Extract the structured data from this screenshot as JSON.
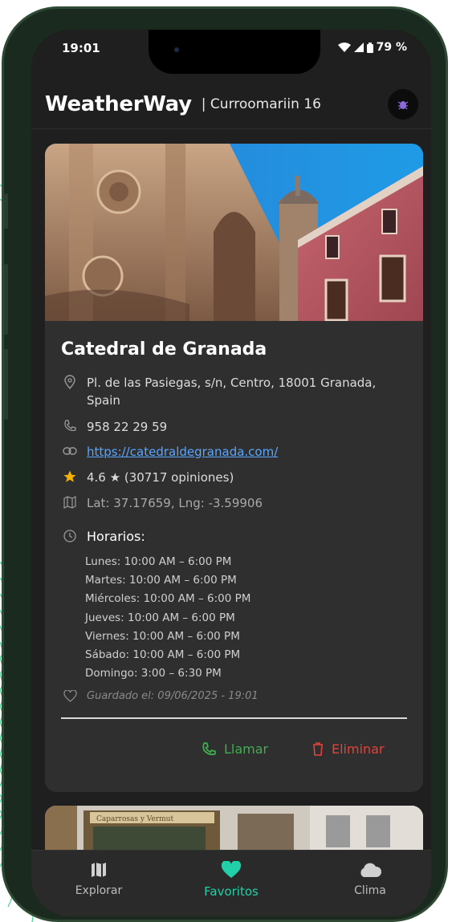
{
  "status_bar": {
    "time": "19:01",
    "battery": "79 %"
  },
  "header": {
    "brand": "WeatherWay",
    "separator": "|",
    "username": "Curroomariin 16"
  },
  "place": {
    "name": "Catedral de Granada",
    "address": "Pl. de las Pasiegas, s/n, Centro, 18001 Granada, Spain",
    "phone": "958 22 29 59",
    "website": "https://catedraldegranada.com/",
    "rating": "4.6 ★ (30717 opiniones)",
    "coords": "Lat: 37.17659, Lng: -3.59906",
    "hours_title": "Horarios:",
    "hours": [
      "Lunes: 10:00 AM – 6:00 PM",
      "Martes: 10:00 AM – 6:00 PM",
      "Miércoles: 10:00 AM – 6:00 PM",
      "Jueves: 10:00 AM – 6:00 PM",
      "Viernes: 10:00 AM – 6:00 PM",
      "Sábado: 10:00 AM – 6:00 PM",
      "Domingo: 3:00 – 6:30 PM"
    ],
    "saved": "Guardado el: 09/06/2025 - 19:01"
  },
  "actions": {
    "call": "Llamar",
    "delete": "Eliminar"
  },
  "second_card": {
    "sign_text": "Caparrosas y Vermut"
  },
  "nav": [
    {
      "label": "Explorar",
      "icon": "map-icon",
      "active": false
    },
    {
      "label": "Favoritos",
      "icon": "heart-icon",
      "active": true
    },
    {
      "label": "Clima",
      "icon": "cloud-icon",
      "active": false
    }
  ],
  "colors": {
    "accent": "#21d0a8",
    "call_green": "#3fae4f",
    "delete_red": "#e5423a",
    "link_blue": "#58a6ff",
    "star": "#f5b301"
  }
}
